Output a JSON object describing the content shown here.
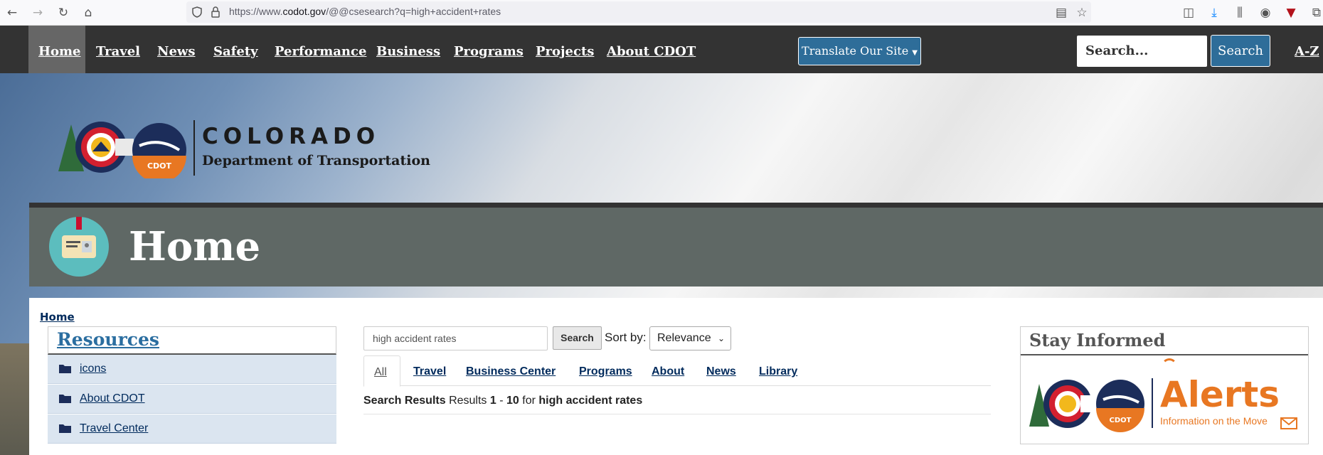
{
  "browser": {
    "url_prefix": "https://www.",
    "url_domain": "codot.gov",
    "url_rest": "/@@csesearch?q=high+accident+rates"
  },
  "nav": {
    "items": [
      "Home",
      "Travel",
      "News",
      "Safety",
      "Performance",
      "Business",
      "Programs",
      "Projects",
      "About CDOT"
    ],
    "translate": "Translate Our Site",
    "search_placeholder": "Search...",
    "search_button": "Search",
    "az": "A-Z"
  },
  "logo": {
    "title": "COLORADO",
    "subtitle": "Department of Transportation",
    "badge_text": "CDOT"
  },
  "banner": {
    "title": "Home"
  },
  "breadcrumb": "Home",
  "resources": {
    "title": "Resources",
    "items": [
      "icons",
      "About CDOT",
      "Travel Center"
    ]
  },
  "search": {
    "query": "high accident rates",
    "button": "Search",
    "sort_label": "Sort by:",
    "sort_value": "Relevance",
    "tabs": [
      "All",
      "Travel",
      "Business Center",
      "Programs",
      "About",
      "News",
      "Library"
    ],
    "results_label": "Search Results",
    "results_word": "Results",
    "range_start": "1",
    "range_sep": "-",
    "range_end": "10",
    "for_word": "for"
  },
  "stay": {
    "title": "Stay Informed",
    "alerts": "Alerts",
    "tagline": "Information on the Move",
    "badge_text": "CDOT"
  },
  "colors": {
    "nav_bg": "#333333",
    "accent": "#2e6d99",
    "banner": "#5f6865",
    "alerts": "#e87722"
  }
}
